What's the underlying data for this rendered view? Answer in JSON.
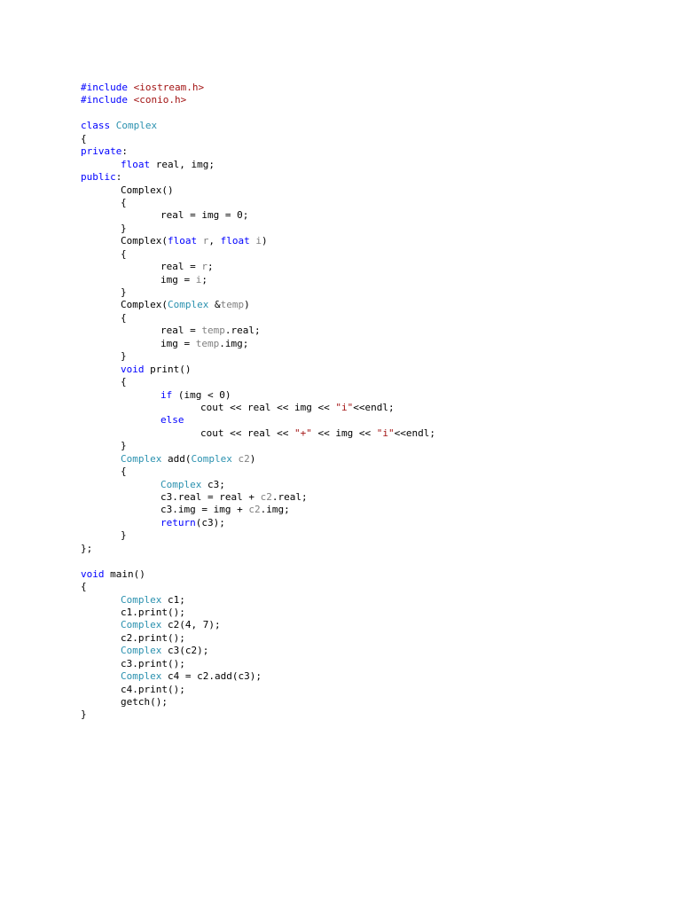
{
  "colors": {
    "plain": "#000000",
    "keyword": "#0000ff",
    "type": "#2b91af",
    "string": "#a31515",
    "param": "#808080",
    "background": "#ffffff"
  },
  "code_lines": [
    [
      [
        "kw",
        "#include "
      ],
      [
        "str",
        "<iostream.h>"
      ]
    ],
    [
      [
        "kw",
        "#include "
      ],
      [
        "str",
        "<conio.h>"
      ]
    ],
    [],
    [
      [
        "kw",
        "class "
      ],
      [
        "type",
        "Complex"
      ]
    ],
    [
      [
        "plain",
        "{"
      ]
    ],
    [
      [
        "kw",
        "private"
      ],
      [
        "plain",
        ":"
      ]
    ],
    [
      [
        "plain",
        "\t"
      ],
      [
        "kw",
        "float"
      ],
      [
        "plain",
        " real, img;"
      ]
    ],
    [
      [
        "kw",
        "public"
      ],
      [
        "plain",
        ":"
      ]
    ],
    [
      [
        "plain",
        "\tComplex()"
      ]
    ],
    [
      [
        "plain",
        "\t{"
      ]
    ],
    [
      [
        "plain",
        "\t\treal = img = 0;"
      ]
    ],
    [
      [
        "plain",
        "\t}"
      ]
    ],
    [
      [
        "plain",
        "\tComplex("
      ],
      [
        "kw",
        "float"
      ],
      [
        "plain",
        " "
      ],
      [
        "param",
        "r"
      ],
      [
        "plain",
        ", "
      ],
      [
        "kw",
        "float"
      ],
      [
        "plain",
        " "
      ],
      [
        "param",
        "i"
      ],
      [
        "plain",
        ")"
      ]
    ],
    [
      [
        "plain",
        "\t{"
      ]
    ],
    [
      [
        "plain",
        "\t\treal = "
      ],
      [
        "param",
        "r"
      ],
      [
        "plain",
        ";"
      ]
    ],
    [
      [
        "plain",
        "\t\timg = "
      ],
      [
        "param",
        "i"
      ],
      [
        "plain",
        ";"
      ]
    ],
    [
      [
        "plain",
        "\t}"
      ]
    ],
    [
      [
        "plain",
        "\tComplex("
      ],
      [
        "type",
        "Complex"
      ],
      [
        "plain",
        " &"
      ],
      [
        "param",
        "temp"
      ],
      [
        "plain",
        ")"
      ]
    ],
    [
      [
        "plain",
        "\t{"
      ]
    ],
    [
      [
        "plain",
        "\t\treal = "
      ],
      [
        "param",
        "temp"
      ],
      [
        "plain",
        ".real;"
      ]
    ],
    [
      [
        "plain",
        "\t\timg = "
      ],
      [
        "param",
        "temp"
      ],
      [
        "plain",
        ".img;"
      ]
    ],
    [
      [
        "plain",
        "\t}"
      ]
    ],
    [
      [
        "plain",
        "\t"
      ],
      [
        "kw",
        "void"
      ],
      [
        "plain",
        " print()"
      ]
    ],
    [
      [
        "plain",
        "\t{"
      ]
    ],
    [
      [
        "plain",
        "\t\t"
      ],
      [
        "kw",
        "if"
      ],
      [
        "plain",
        " (img < 0)"
      ]
    ],
    [
      [
        "plain",
        "\t\t\tcout << real << img << "
      ],
      [
        "str",
        "\"i\""
      ],
      [
        "plain",
        "<<endl;"
      ]
    ],
    [
      [
        "plain",
        "\t\t"
      ],
      [
        "kw",
        "else"
      ]
    ],
    [
      [
        "plain",
        "\t\t\tcout << real << "
      ],
      [
        "str",
        "\"+\""
      ],
      [
        "plain",
        " << img << "
      ],
      [
        "str",
        "\"i\""
      ],
      [
        "plain",
        "<<endl;"
      ]
    ],
    [
      [
        "plain",
        "\t}"
      ]
    ],
    [
      [
        "plain",
        "\t"
      ],
      [
        "type",
        "Complex"
      ],
      [
        "plain",
        " add("
      ],
      [
        "type",
        "Complex"
      ],
      [
        "plain",
        " "
      ],
      [
        "param",
        "c2"
      ],
      [
        "plain",
        ")"
      ]
    ],
    [
      [
        "plain",
        "\t{"
      ]
    ],
    [
      [
        "plain",
        "\t\t"
      ],
      [
        "type",
        "Complex"
      ],
      [
        "plain",
        " c3;"
      ]
    ],
    [
      [
        "plain",
        "\t\tc3.real = real + "
      ],
      [
        "param",
        "c2"
      ],
      [
        "plain",
        ".real;"
      ]
    ],
    [
      [
        "plain",
        "\t\tc3.img = img + "
      ],
      [
        "param",
        "c2"
      ],
      [
        "plain",
        ".img;"
      ]
    ],
    [
      [
        "plain",
        "\t\t"
      ],
      [
        "kw",
        "return"
      ],
      [
        "plain",
        "(c3);"
      ]
    ],
    [
      [
        "plain",
        "\t}"
      ]
    ],
    [
      [
        "plain",
        "};"
      ]
    ],
    [],
    [
      [
        "kw",
        "void"
      ],
      [
        "plain",
        " main()"
      ]
    ],
    [
      [
        "plain",
        "{"
      ]
    ],
    [
      [
        "plain",
        "\t"
      ],
      [
        "type",
        "Complex"
      ],
      [
        "plain",
        " c1;"
      ]
    ],
    [
      [
        "plain",
        "\tc1.print();"
      ]
    ],
    [
      [
        "plain",
        "\t"
      ],
      [
        "type",
        "Complex"
      ],
      [
        "plain",
        " c2(4, 7);"
      ]
    ],
    [
      [
        "plain",
        "\tc2.print();"
      ]
    ],
    [
      [
        "plain",
        "\t"
      ],
      [
        "type",
        "Complex"
      ],
      [
        "plain",
        " c3(c2);"
      ]
    ],
    [
      [
        "plain",
        "\tc3.print();"
      ]
    ],
    [
      [
        "plain",
        "\t"
      ],
      [
        "type",
        "Complex"
      ],
      [
        "plain",
        " c4 = c2.add(c3);"
      ]
    ],
    [
      [
        "plain",
        "\tc4.print();"
      ]
    ],
    [
      [
        "plain",
        "\tgetch();"
      ]
    ],
    [
      [
        "plain",
        "}"
      ]
    ]
  ]
}
